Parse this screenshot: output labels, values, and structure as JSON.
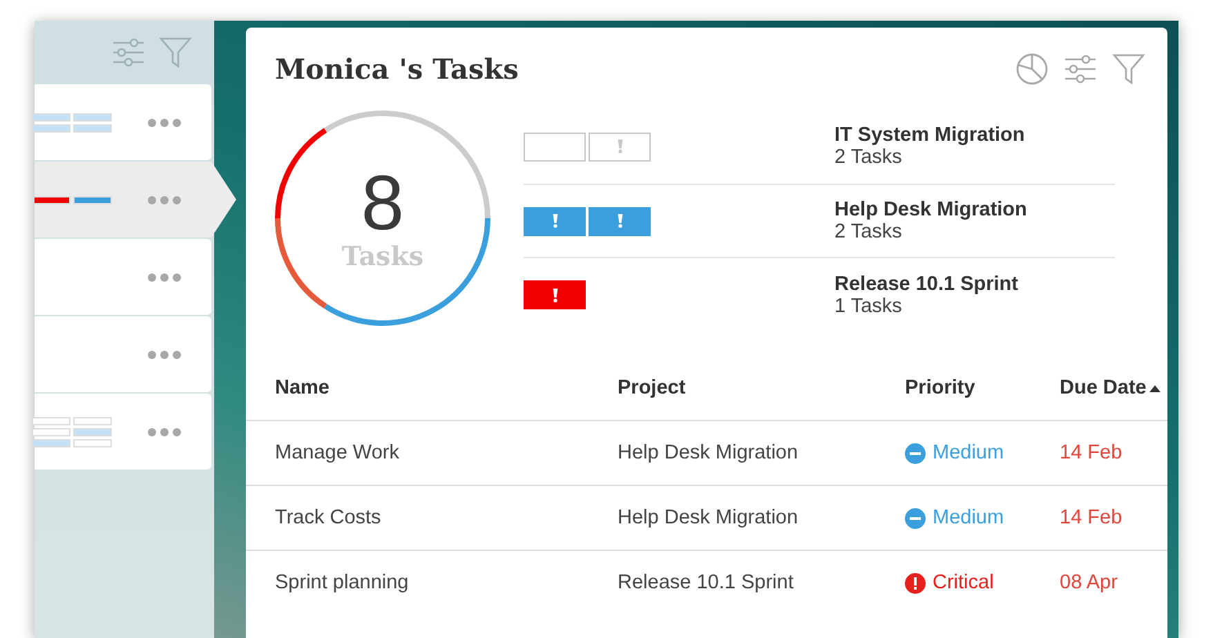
{
  "side_list": {
    "rows": [
      {
        "selected": false,
        "tiles": [
          [
            {
              "color": "#c4e0f4"
            },
            {
              "color": "#c4e0f4"
            }
          ],
          [
            {
              "color": "#c4e0f4"
            },
            {
              "color": "#c4e0f4"
            }
          ]
        ]
      },
      {
        "selected": true,
        "tiles": [
          [
            {
              "color": "#f20000"
            },
            {
              "color": "#3a9fdc"
            }
          ]
        ]
      },
      {
        "selected": false,
        "tiles": []
      },
      {
        "selected": false,
        "tiles": []
      },
      {
        "selected": false,
        "tiles": [
          [
            {
              "color": "#ffffff"
            },
            {
              "color": "#ffffff"
            }
          ],
          [
            {
              "color": "#ffffff"
            },
            {
              "color": "#c4e0f4"
            }
          ],
          [
            {
              "color": "#c4e0f4"
            },
            {
              "color": "#ffffff"
            }
          ]
        ]
      }
    ]
  },
  "card": {
    "title": "Monica 's Tasks",
    "summary": {
      "count": "8",
      "count_label": "Tasks"
    },
    "projects": [
      {
        "name": "IT System Migration",
        "tasks": "2 Tasks",
        "tiles": [
          {
            "color": "#ffffff",
            "flagged": false
          },
          {
            "color": "#ffffff",
            "flagged": true
          }
        ]
      },
      {
        "name": "Help Desk Migration",
        "tasks": "2 Tasks",
        "tiles": [
          {
            "color": "#3a9fdc",
            "flagged": true
          },
          {
            "color": "#3a9fdc",
            "flagged": true
          }
        ]
      },
      {
        "name": "Release 10.1 Sprint",
        "tasks": "1 Tasks",
        "tiles": [
          {
            "color": "#f20000",
            "flagged": true
          }
        ]
      }
    ],
    "table": {
      "columns": [
        {
          "label": "Name",
          "sorted": false
        },
        {
          "label": "Project",
          "sorted": false
        },
        {
          "label": "Priority",
          "sorted": false
        },
        {
          "label": "Due Date",
          "sorted": true
        }
      ],
      "rows": [
        {
          "name": "Manage Work",
          "project": "Help Desk Migration",
          "priority": {
            "kind": "medium",
            "label": "Medium"
          },
          "due": "14 Feb"
        },
        {
          "name": "Track Costs",
          "project": "Help Desk Migration",
          "priority": {
            "kind": "medium",
            "label": "Medium"
          },
          "due": "14 Feb"
        },
        {
          "name": "Sprint planning",
          "project": "Release 10.1 Sprint",
          "priority": {
            "kind": "critical",
            "label": "Critical"
          },
          "due": "08 Apr"
        }
      ]
    }
  }
}
